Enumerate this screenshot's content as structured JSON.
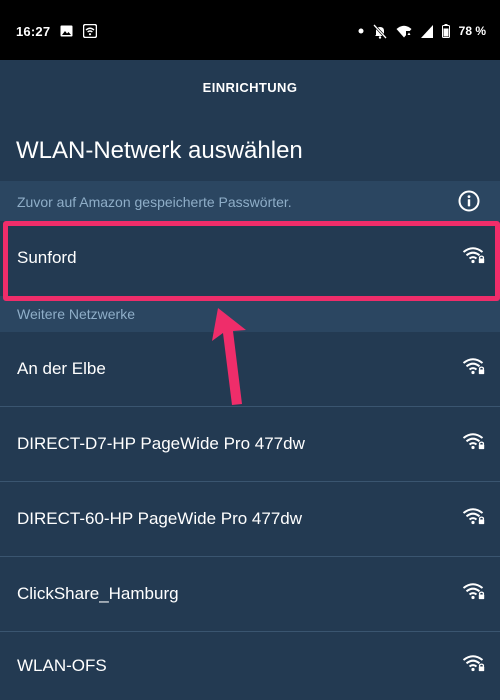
{
  "status_bar": {
    "time": "16:27",
    "battery": "78 %",
    "icons": [
      "image-icon",
      "wifi-notification-icon",
      "dot-icon",
      "mute-icon",
      "wifi-icon",
      "signal-icon",
      "battery-icon"
    ]
  },
  "header": {
    "title": "EINRICHTUNG"
  },
  "page": {
    "title": "WLAN-Netwerk auswählen"
  },
  "saved_section": {
    "label": "Zuvor auf Amazon gespeicherte Passwörter.",
    "networks": [
      {
        "name": "Sunford",
        "icon": "wifi-lock-icon"
      }
    ]
  },
  "more_section": {
    "label": "Weitere Netzwerke",
    "networks": [
      {
        "name": "An der Elbe",
        "icon": "wifi-lock-icon"
      },
      {
        "name": "DIRECT-D7-HP PageWide Pro 477dw",
        "icon": "wifi-lock-icon"
      },
      {
        "name": "DIRECT-60-HP PageWide Pro 477dw",
        "icon": "wifi-lock-icon"
      },
      {
        "name": "ClickShare_Hamburg",
        "icon": "wifi-lock-icon"
      },
      {
        "name": "WLAN-OFS",
        "icon": "wifi-lock-icon"
      }
    ]
  },
  "colors": {
    "background": "#233a52",
    "section_band": "#2b4661",
    "section_text": "#8faec8",
    "highlight": "#ef2d6a",
    "status_bar": "#000000"
  }
}
